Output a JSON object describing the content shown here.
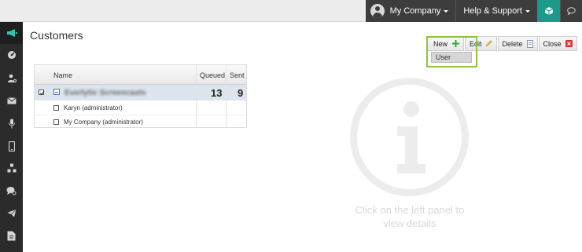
{
  "topbar": {
    "company_label": "My Company",
    "help_label": "Help & Support",
    "cube_icon": "cube-icon",
    "chat_icon": "chat-bubble-icon"
  },
  "sidebar": {
    "items": [
      {
        "icon": "megaphone-icon",
        "active": true
      },
      {
        "icon": "dashboard-gauge-icon"
      },
      {
        "icon": "user-key-icon"
      },
      {
        "icon": "envelope-icon"
      },
      {
        "icon": "microphone-icon"
      },
      {
        "icon": "mobile-phone-icon"
      },
      {
        "icon": "hierarchy-icon"
      },
      {
        "icon": "chat-gear-icon"
      },
      {
        "icon": "paper-plane-icon"
      },
      {
        "icon": "document-report-icon"
      }
    ],
    "accent_color": "#2cc7b1"
  },
  "page": {
    "title": "Customers"
  },
  "grid": {
    "headers": {
      "name": "Name",
      "queued": "Queued",
      "sent": "Sent"
    },
    "group_row": {
      "name": "Everlytic Screencasts",
      "queued": "13",
      "sent": "9"
    },
    "rows": [
      {
        "name": "Karyn (administrator)"
      },
      {
        "name": "My Company (administrator)"
      }
    ]
  },
  "toolbar": {
    "new_label": "New",
    "edit_label": "Edit",
    "delete_label": "Delete",
    "close_label": "Close",
    "dropdown_item": "User",
    "highlight_color": "#8dc63f"
  },
  "info_panel": {
    "line1": "Click on the left panel to",
    "line2": "view details"
  }
}
